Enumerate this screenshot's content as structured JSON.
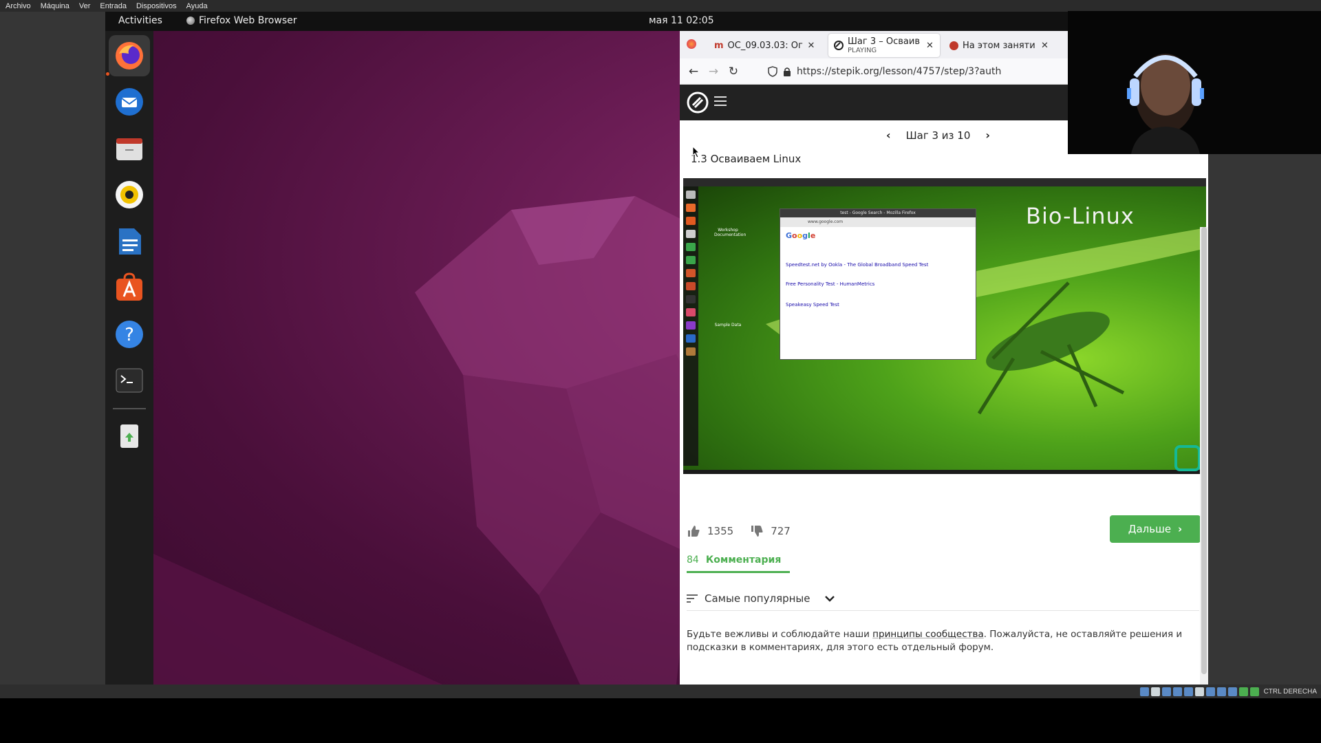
{
  "host_menu": [
    "Archivo",
    "Máquina",
    "Ver",
    "Entrada",
    "Dispositivos",
    "Ayuda"
  ],
  "host_status": {
    "host_key": "CTRL DERECHA"
  },
  "topbar": {
    "activities": "Activities",
    "app_name": "Firefox Web Browser",
    "clock": "мая 11  02:05"
  },
  "dock": {
    "items": [
      {
        "name": "firefox-icon",
        "active": true
      },
      {
        "name": "thunderbird-icon"
      },
      {
        "name": "files-icon"
      },
      {
        "name": "rhythmbox-icon"
      },
      {
        "name": "writer-icon"
      },
      {
        "name": "software-icon"
      },
      {
        "name": "help-icon"
      },
      {
        "name": "terminal-icon"
      },
      {
        "name": "trash-icon"
      }
    ]
  },
  "browser": {
    "tabs": [
      {
        "title": "ОС_09.03.03: Ог"
      },
      {
        "title": "Шаг 3 – Осваив",
        "subtitle": "PLAYING"
      },
      {
        "title": "На этом заняти"
      }
    ],
    "url": "https://stepik.org/lesson/4757/step/3?auth"
  },
  "stepik": {
    "step_indicator": "Шаг 3 из 10",
    "lesson_title": "1.3 Осваиваем Linux",
    "video": {
      "overlay_text": "Bio-Linux",
      "inner_window_title": "test - Google Search - Mozilla Firefox",
      "inner_url": "www.google.com",
      "results": [
        "Speedtest.net by Ookla - The Global Broadband Speed Test",
        "Free Personality Test - HumanMetrics",
        "Speakeasy Speed Test"
      ],
      "desktop_labels": [
        "Workshop Documentation",
        "Sample Data"
      ]
    },
    "likes": "1355",
    "dislikes": "727",
    "next_button": "Дальше",
    "comments_count": "84",
    "comments_label": "Комментария",
    "sort_label": "Самые популярные",
    "notice_before": "Будьте вежливы и соблюдайте наши ",
    "notice_link": "принципы сообщества",
    "notice_after": ". Пожалуйста, не оставляйте решения и подсказки в комментариях, для этого есть отдельный форум."
  },
  "colors": {
    "accent_green": "#4caf50",
    "ubuntu_orange": "#e95420",
    "wallpaper": "#6a1c54"
  }
}
